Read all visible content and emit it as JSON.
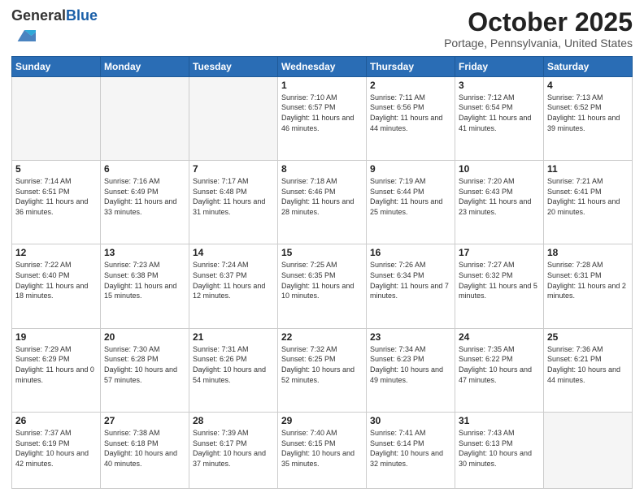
{
  "logo": {
    "general": "General",
    "blue": "Blue"
  },
  "header": {
    "month": "October 2025",
    "location": "Portage, Pennsylvania, United States"
  },
  "weekdays": [
    "Sunday",
    "Monday",
    "Tuesday",
    "Wednesday",
    "Thursday",
    "Friday",
    "Saturday"
  ],
  "weeks": [
    [
      {
        "day": "",
        "sunrise": "",
        "sunset": "",
        "daylight": "",
        "empty": true
      },
      {
        "day": "",
        "sunrise": "",
        "sunset": "",
        "daylight": "",
        "empty": true
      },
      {
        "day": "",
        "sunrise": "",
        "sunset": "",
        "daylight": "",
        "empty": true
      },
      {
        "day": "1",
        "sunrise": "Sunrise: 7:10 AM",
        "sunset": "Sunset: 6:57 PM",
        "daylight": "Daylight: 11 hours and 46 minutes."
      },
      {
        "day": "2",
        "sunrise": "Sunrise: 7:11 AM",
        "sunset": "Sunset: 6:56 PM",
        "daylight": "Daylight: 11 hours and 44 minutes."
      },
      {
        "day": "3",
        "sunrise": "Sunrise: 7:12 AM",
        "sunset": "Sunset: 6:54 PM",
        "daylight": "Daylight: 11 hours and 41 minutes."
      },
      {
        "day": "4",
        "sunrise": "Sunrise: 7:13 AM",
        "sunset": "Sunset: 6:52 PM",
        "daylight": "Daylight: 11 hours and 39 minutes."
      }
    ],
    [
      {
        "day": "5",
        "sunrise": "Sunrise: 7:14 AM",
        "sunset": "Sunset: 6:51 PM",
        "daylight": "Daylight: 11 hours and 36 minutes."
      },
      {
        "day": "6",
        "sunrise": "Sunrise: 7:16 AM",
        "sunset": "Sunset: 6:49 PM",
        "daylight": "Daylight: 11 hours and 33 minutes."
      },
      {
        "day": "7",
        "sunrise": "Sunrise: 7:17 AM",
        "sunset": "Sunset: 6:48 PM",
        "daylight": "Daylight: 11 hours and 31 minutes."
      },
      {
        "day": "8",
        "sunrise": "Sunrise: 7:18 AM",
        "sunset": "Sunset: 6:46 PM",
        "daylight": "Daylight: 11 hours and 28 minutes."
      },
      {
        "day": "9",
        "sunrise": "Sunrise: 7:19 AM",
        "sunset": "Sunset: 6:44 PM",
        "daylight": "Daylight: 11 hours and 25 minutes."
      },
      {
        "day": "10",
        "sunrise": "Sunrise: 7:20 AM",
        "sunset": "Sunset: 6:43 PM",
        "daylight": "Daylight: 11 hours and 23 minutes."
      },
      {
        "day": "11",
        "sunrise": "Sunrise: 7:21 AM",
        "sunset": "Sunset: 6:41 PM",
        "daylight": "Daylight: 11 hours and 20 minutes."
      }
    ],
    [
      {
        "day": "12",
        "sunrise": "Sunrise: 7:22 AM",
        "sunset": "Sunset: 6:40 PM",
        "daylight": "Daylight: 11 hours and 18 minutes."
      },
      {
        "day": "13",
        "sunrise": "Sunrise: 7:23 AM",
        "sunset": "Sunset: 6:38 PM",
        "daylight": "Daylight: 11 hours and 15 minutes."
      },
      {
        "day": "14",
        "sunrise": "Sunrise: 7:24 AM",
        "sunset": "Sunset: 6:37 PM",
        "daylight": "Daylight: 11 hours and 12 minutes."
      },
      {
        "day": "15",
        "sunrise": "Sunrise: 7:25 AM",
        "sunset": "Sunset: 6:35 PM",
        "daylight": "Daylight: 11 hours and 10 minutes."
      },
      {
        "day": "16",
        "sunrise": "Sunrise: 7:26 AM",
        "sunset": "Sunset: 6:34 PM",
        "daylight": "Daylight: 11 hours and 7 minutes."
      },
      {
        "day": "17",
        "sunrise": "Sunrise: 7:27 AM",
        "sunset": "Sunset: 6:32 PM",
        "daylight": "Daylight: 11 hours and 5 minutes."
      },
      {
        "day": "18",
        "sunrise": "Sunrise: 7:28 AM",
        "sunset": "Sunset: 6:31 PM",
        "daylight": "Daylight: 11 hours and 2 minutes."
      }
    ],
    [
      {
        "day": "19",
        "sunrise": "Sunrise: 7:29 AM",
        "sunset": "Sunset: 6:29 PM",
        "daylight": "Daylight: 11 hours and 0 minutes."
      },
      {
        "day": "20",
        "sunrise": "Sunrise: 7:30 AM",
        "sunset": "Sunset: 6:28 PM",
        "daylight": "Daylight: 10 hours and 57 minutes."
      },
      {
        "day": "21",
        "sunrise": "Sunrise: 7:31 AM",
        "sunset": "Sunset: 6:26 PM",
        "daylight": "Daylight: 10 hours and 54 minutes."
      },
      {
        "day": "22",
        "sunrise": "Sunrise: 7:32 AM",
        "sunset": "Sunset: 6:25 PM",
        "daylight": "Daylight: 10 hours and 52 minutes."
      },
      {
        "day": "23",
        "sunrise": "Sunrise: 7:34 AM",
        "sunset": "Sunset: 6:23 PM",
        "daylight": "Daylight: 10 hours and 49 minutes."
      },
      {
        "day": "24",
        "sunrise": "Sunrise: 7:35 AM",
        "sunset": "Sunset: 6:22 PM",
        "daylight": "Daylight: 10 hours and 47 minutes."
      },
      {
        "day": "25",
        "sunrise": "Sunrise: 7:36 AM",
        "sunset": "Sunset: 6:21 PM",
        "daylight": "Daylight: 10 hours and 44 minutes."
      }
    ],
    [
      {
        "day": "26",
        "sunrise": "Sunrise: 7:37 AM",
        "sunset": "Sunset: 6:19 PM",
        "daylight": "Daylight: 10 hours and 42 minutes."
      },
      {
        "day": "27",
        "sunrise": "Sunrise: 7:38 AM",
        "sunset": "Sunset: 6:18 PM",
        "daylight": "Daylight: 10 hours and 40 minutes."
      },
      {
        "day": "28",
        "sunrise": "Sunrise: 7:39 AM",
        "sunset": "Sunset: 6:17 PM",
        "daylight": "Daylight: 10 hours and 37 minutes."
      },
      {
        "day": "29",
        "sunrise": "Sunrise: 7:40 AM",
        "sunset": "Sunset: 6:15 PM",
        "daylight": "Daylight: 10 hours and 35 minutes."
      },
      {
        "day": "30",
        "sunrise": "Sunrise: 7:41 AM",
        "sunset": "Sunset: 6:14 PM",
        "daylight": "Daylight: 10 hours and 32 minutes."
      },
      {
        "day": "31",
        "sunrise": "Sunrise: 7:43 AM",
        "sunset": "Sunset: 6:13 PM",
        "daylight": "Daylight: 10 hours and 30 minutes."
      },
      {
        "day": "",
        "sunrise": "",
        "sunset": "",
        "daylight": "",
        "empty": true
      }
    ]
  ]
}
